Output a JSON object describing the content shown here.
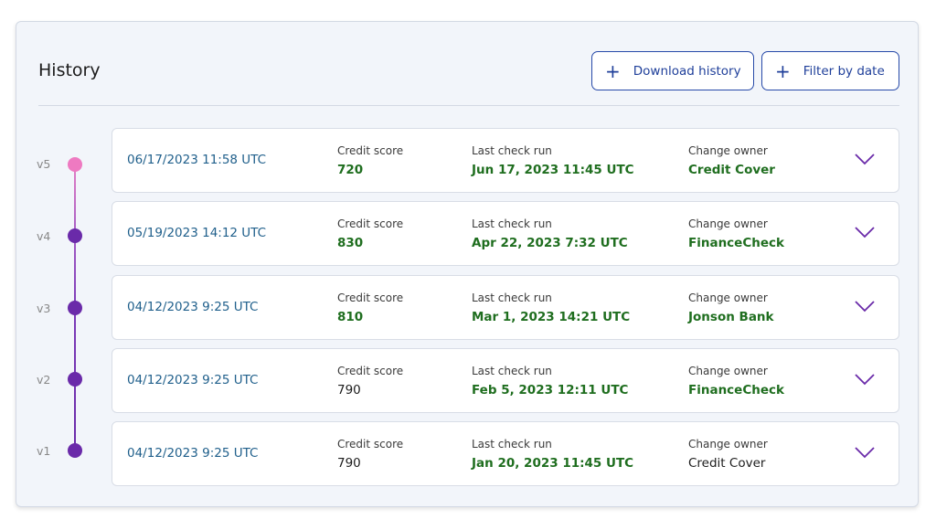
{
  "header": {
    "title": "History",
    "download_label": "Download history",
    "filter_label": "Filter by date"
  },
  "labels": {
    "credit_score": "Credit score",
    "last_check": "Last check run",
    "change_owner": "Change owner"
  },
  "colors": {
    "accent": "#2649a8",
    "date_text": "#1f5f8b",
    "positive_text": "#1f6e1f",
    "timeline_top": "#ee7ac1",
    "timeline_dot": "#6a2aa9",
    "chevron": "#6a2aa9"
  },
  "history": [
    {
      "version": "v5",
      "date": "06/17/2023 11:58 UTC",
      "credit_score": "720",
      "credit_score_highlight": true,
      "last_check": "Jun 17, 2023 11:45 UTC",
      "owner": "Credit Cover",
      "owner_highlight": true
    },
    {
      "version": "v4",
      "date": "05/19/2023 14:12 UTC",
      "credit_score": "830",
      "credit_score_highlight": true,
      "last_check": "Apr 22, 2023 7:32 UTC",
      "owner": "FinanceCheck",
      "owner_highlight": true
    },
    {
      "version": "v3",
      "date": "04/12/2023 9:25 UTC",
      "credit_score": "810",
      "credit_score_highlight": true,
      "last_check": "Mar 1, 2023 14:21 UTC",
      "owner": "Jonson Bank",
      "owner_highlight": true
    },
    {
      "version": "v2",
      "date": "04/12/2023 9:25 UTC",
      "credit_score": "790",
      "credit_score_highlight": false,
      "last_check": "Feb 5, 2023 12:11 UTC",
      "owner": "FinanceCheck",
      "owner_highlight": true
    },
    {
      "version": "v1",
      "date": "04/12/2023 9:25 UTC",
      "credit_score": "790",
      "credit_score_highlight": false,
      "last_check": "Jan 20, 2023 11:45 UTC",
      "owner": "Credit Cover",
      "owner_highlight": false
    }
  ]
}
